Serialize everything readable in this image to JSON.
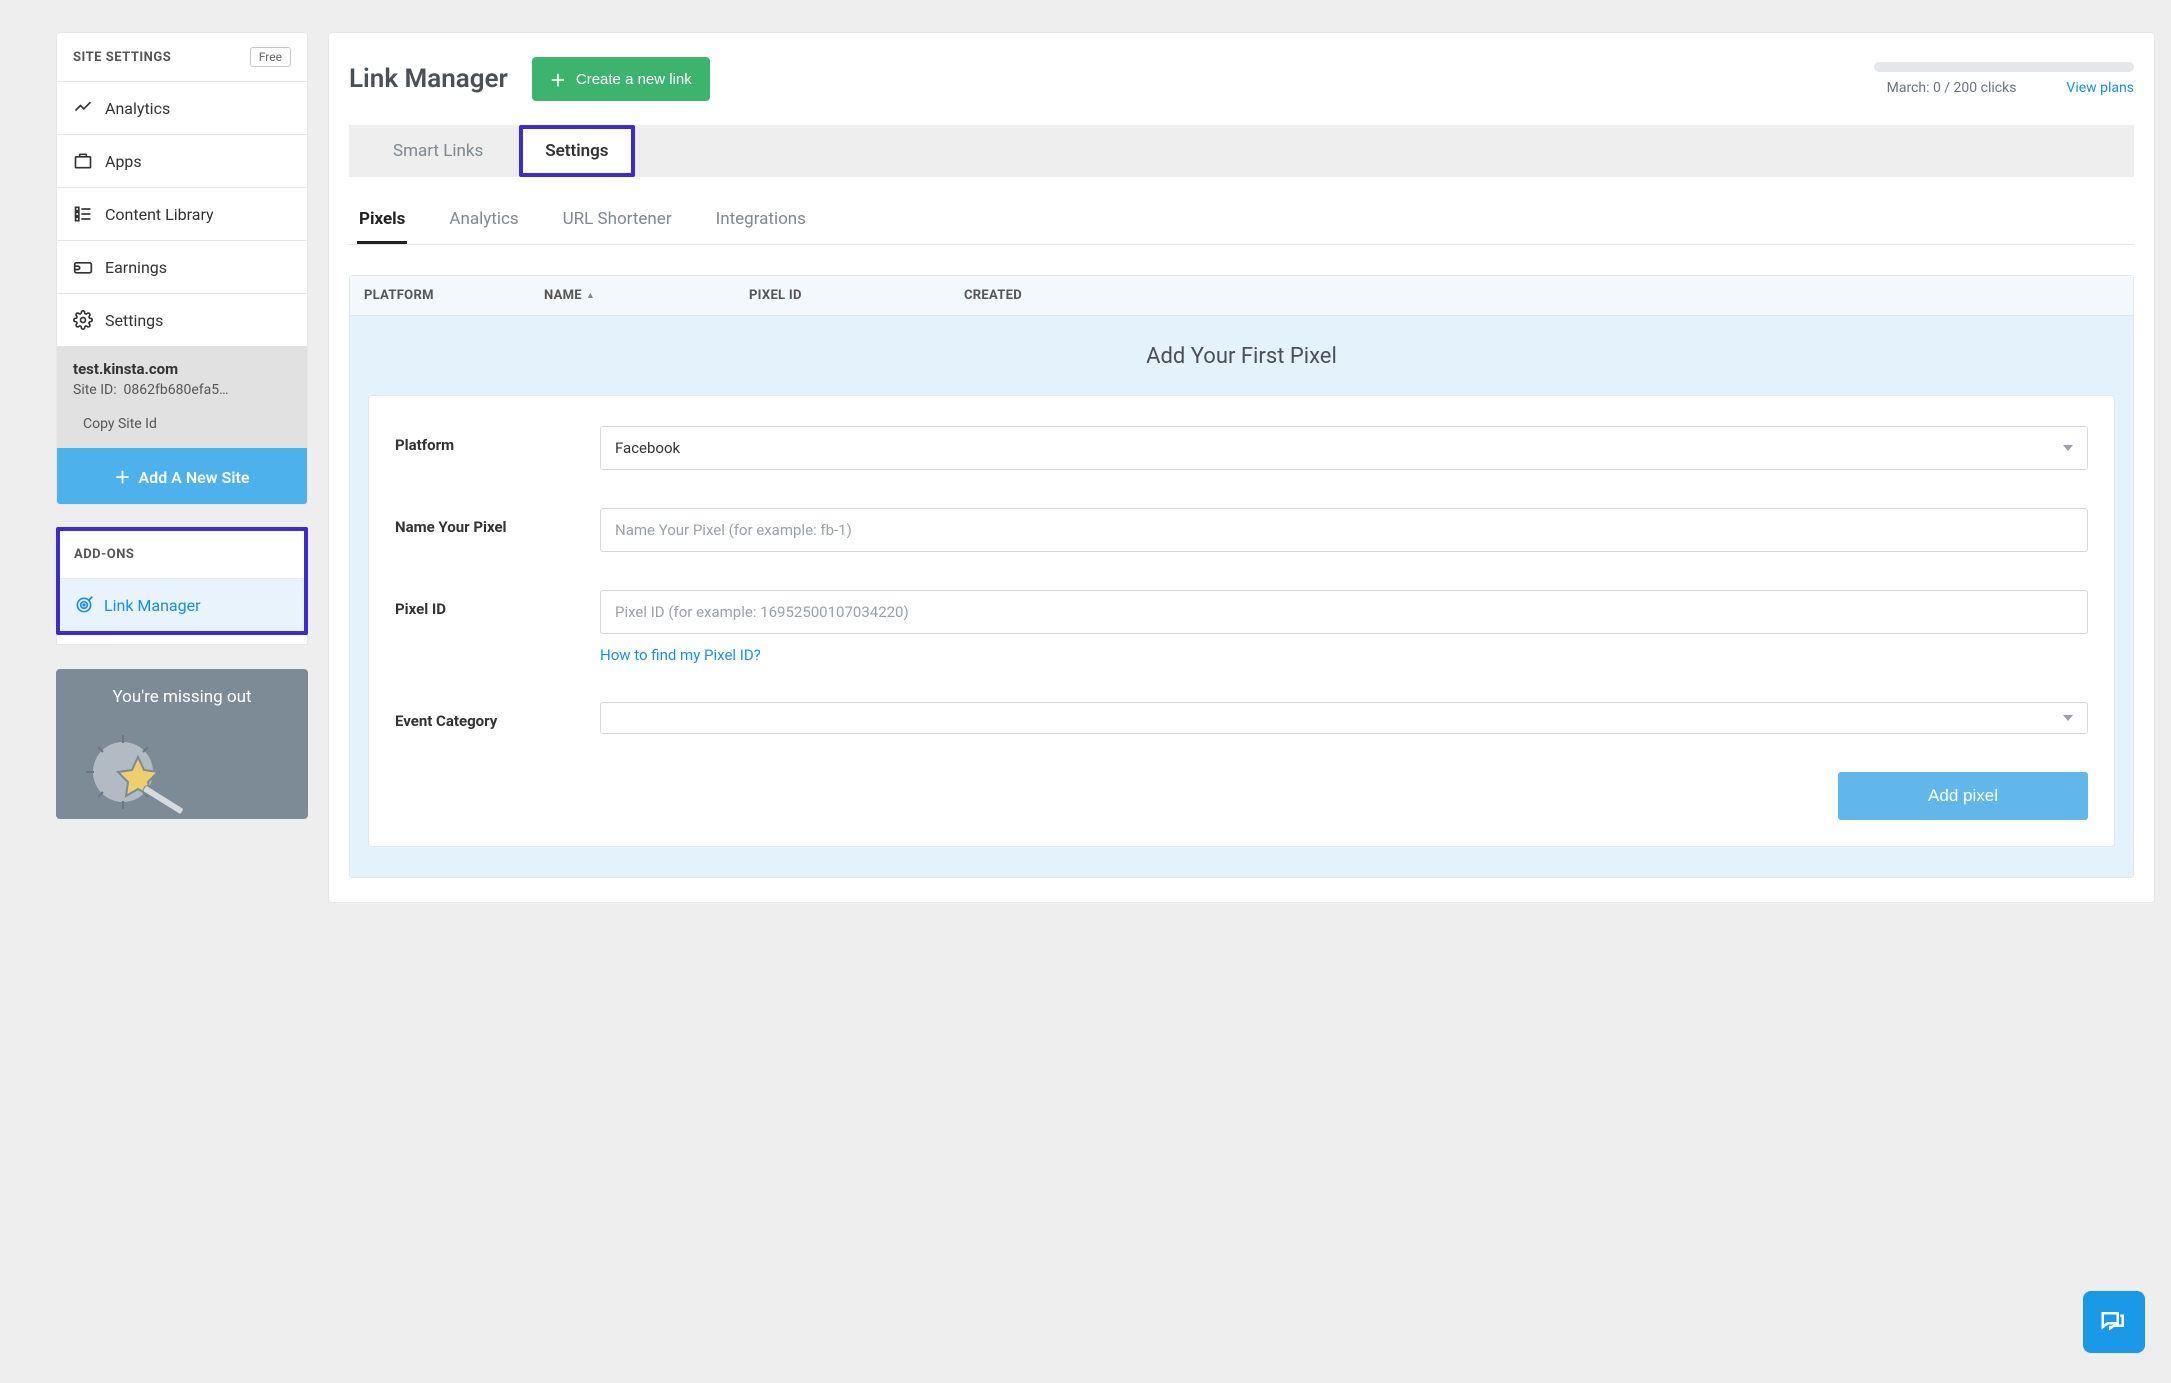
{
  "sidebar": {
    "header_title": "SITE SETTINGS",
    "badge": "Free",
    "nav": {
      "analytics": "Analytics",
      "apps": "Apps",
      "content_library": "Content Library",
      "earnings": "Earnings",
      "settings": "Settings"
    },
    "site": {
      "url": "test.kinsta.com",
      "site_id_label": "Site ID:",
      "site_id_value": "0862fb680efa5…",
      "copy_label": "Copy Site Id"
    },
    "add_site_button": "Add A New Site",
    "addons_header": "ADD-ONS",
    "addons": {
      "link_manager": "Link Manager"
    },
    "promo_title": "You're missing out"
  },
  "main": {
    "title": "Link Manager",
    "create_button": "Create a new link",
    "usage_text": "March: 0 / 200 clicks",
    "view_plans": "View plans",
    "tabs": {
      "smart_links": "Smart Links",
      "settings": "Settings"
    },
    "subtabs": {
      "pixels": "Pixels",
      "analytics": "Analytics",
      "url_shortener": "URL Shortener",
      "integrations": "Integrations"
    },
    "table": {
      "headers": {
        "platform": "PLATFORM",
        "name": "NAME",
        "pixel_id": "PIXEL ID",
        "created": "CREATED"
      }
    },
    "first_pixel": {
      "title": "Add Your First Pixel",
      "labels": {
        "platform": "Platform",
        "name": "Name Your Pixel",
        "pixel_id": "Pixel ID",
        "event_category": "Event Category"
      },
      "platform_value": "Facebook",
      "name_placeholder": "Name Your Pixel (for example: fb-1)",
      "pixel_id_placeholder": "Pixel ID (for example: 16952500107034220)",
      "help_link": "How to find my Pixel ID?",
      "add_button": "Add pixel"
    }
  }
}
